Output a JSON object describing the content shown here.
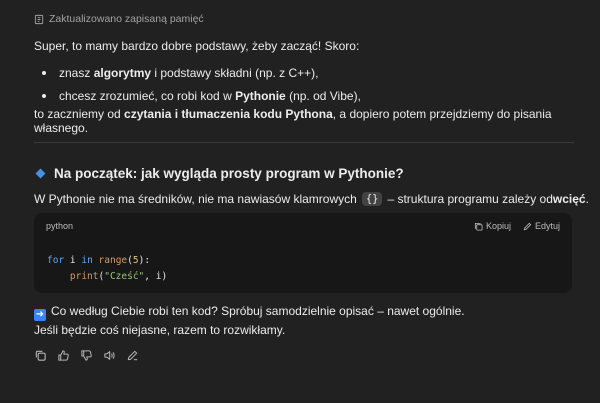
{
  "memory_label": "Zaktualizowano zapisaną pamięć",
  "intro": "Super, to mamy bardzo dobre podstawy, żeby zacząć! Skoro:",
  "bullets": [
    {
      "pre": "znasz ",
      "bold": "algorytmy",
      "post": " i podstawy składni (np. z C++),"
    },
    {
      "pre": "chcesz zrozumieć, co robi kod w ",
      "bold": "Pythonie",
      "post": " (np. od Vibe),"
    }
  ],
  "para2": {
    "pre": "to zaczniemy od ",
    "bold": "czytania i tłumaczenia kodu Pythona",
    "post": ", a dopiero potem przejdziemy do pisania własnego."
  },
  "heading": "Na początek: jak wygląda prosty program w Pythonie?",
  "para3": {
    "pre": "W Pythonie nie ma średników, nie ma nawiasów klamrowych",
    "code": "{}",
    "mid": "– struktura programu zależy od ",
    "bold": "wcięć",
    "post": "."
  },
  "codeblock": {
    "language": "python",
    "copy_label": "Kopiuj",
    "edit_label": "Edytuj",
    "line1": {
      "kw1": "for",
      "var": " i ",
      "kw2": "in",
      "sp": " ",
      "fn": "range",
      "open": "(",
      "num": "5",
      "close": "):"
    },
    "line2": {
      "indent": "    ",
      "fn": "print",
      "open": "(",
      "str": "\"Cześć\"",
      "rest": ", i)"
    }
  },
  "question": "Co według Ciebie robi ten kod? Spróbuj samodzielnie opisać – nawet ogólnie.",
  "followup": "Jeśli będzie coś niejasne, razem to rozwikłamy.",
  "icons": {
    "arrow": "right-arrow-emoji",
    "actions": [
      "copy-icon",
      "thumbs-up-icon",
      "thumbs-down-icon",
      "read-aloud-icon",
      "edit-icon"
    ]
  }
}
